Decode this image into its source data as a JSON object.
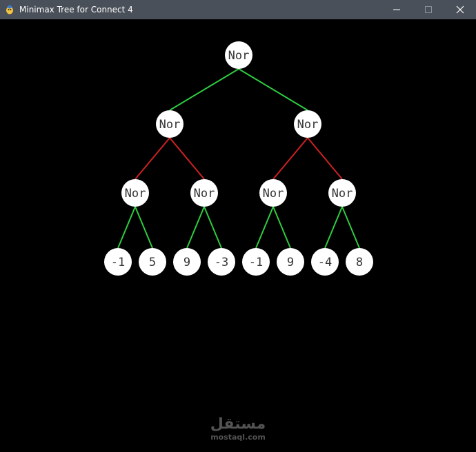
{
  "window": {
    "title": "Minimax Tree for Connect 4",
    "controls": [
      "minimize-icon",
      "maximize-icon",
      "close-icon"
    ]
  },
  "colors": {
    "titlebar": "#4a5059",
    "background": "#000000",
    "node_fill": "#ffffff",
    "node_text": "#333333",
    "edge_max": "#2ecc40",
    "edge_min": "#cc2222"
  },
  "tree": {
    "root": {
      "label": "Nor"
    },
    "level1": [
      {
        "label": "Nor"
      },
      {
        "label": "Nor"
      }
    ],
    "level2": [
      {
        "label": "Nor"
      },
      {
        "label": "Nor"
      },
      {
        "label": "Nor"
      },
      {
        "label": "Nor"
      }
    ],
    "leaves": [
      {
        "label": "-1"
      },
      {
        "label": "5"
      },
      {
        "label": "9"
      },
      {
        "label": "-3"
      },
      {
        "label": "-1"
      },
      {
        "label": "9"
      },
      {
        "label": "-4"
      },
      {
        "label": "8"
      }
    ],
    "edge_colors_by_depth": [
      "green",
      "red",
      "green"
    ]
  },
  "watermark": {
    "arabic": "مستقل",
    "latin": "mostaql.com"
  }
}
